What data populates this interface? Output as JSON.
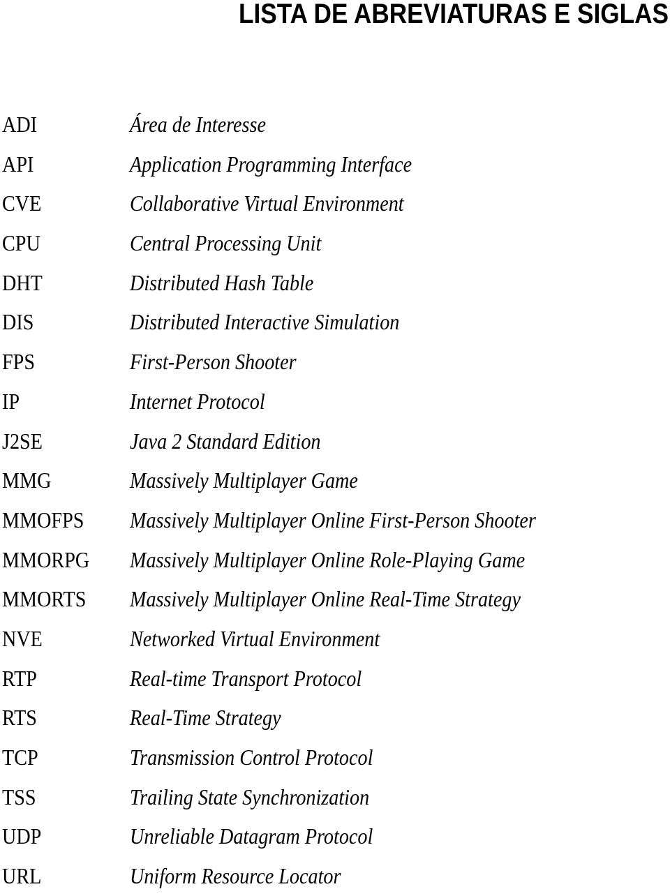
{
  "page": {
    "title": "LISTA DE ABREVIATURAS E SIGLAS"
  },
  "abbreviations": [
    {
      "term": "ADI",
      "definition": "Área de Interesse"
    },
    {
      "term": "API",
      "definition": "Application Programming Interface"
    },
    {
      "term": "CVE",
      "definition": "Collaborative Virtual Environment"
    },
    {
      "term": "CPU",
      "definition": "Central Processing Unit"
    },
    {
      "term": "DHT",
      "definition": "Distributed Hash Table"
    },
    {
      "term": "DIS",
      "definition": "Distributed Interactive Simulation"
    },
    {
      "term": "FPS",
      "definition": "First-Person Shooter"
    },
    {
      "term": "IP",
      "definition": "Internet Protocol"
    },
    {
      "term": "J2SE",
      "definition": "Java 2 Standard Edition"
    },
    {
      "term": "MMG",
      "definition": "Massively Multiplayer Game"
    },
    {
      "term": "MMOFPS",
      "definition": "Massively Multiplayer Online First-Person Shooter"
    },
    {
      "term": "MMORPG",
      "definition": "Massively Multiplayer Online Role-Playing Game"
    },
    {
      "term": "MMORTS",
      "definition": "Massively Multiplayer Online Real-Time Strategy"
    },
    {
      "term": "NVE",
      "definition": "Networked Virtual Environment"
    },
    {
      "term": "RTP",
      "definition": "Real-time Transport Protocol"
    },
    {
      "term": "RTS",
      "definition": "Real-Time Strategy"
    },
    {
      "term": "TCP",
      "definition": "Transmission Control Protocol"
    },
    {
      "term": "TSS",
      "definition": "Trailing State Synchronization"
    },
    {
      "term": "UDP",
      "definition": "Unreliable Datagram Protocol"
    },
    {
      "term": "URL",
      "definition": "Uniform Resource Locator"
    }
  ]
}
